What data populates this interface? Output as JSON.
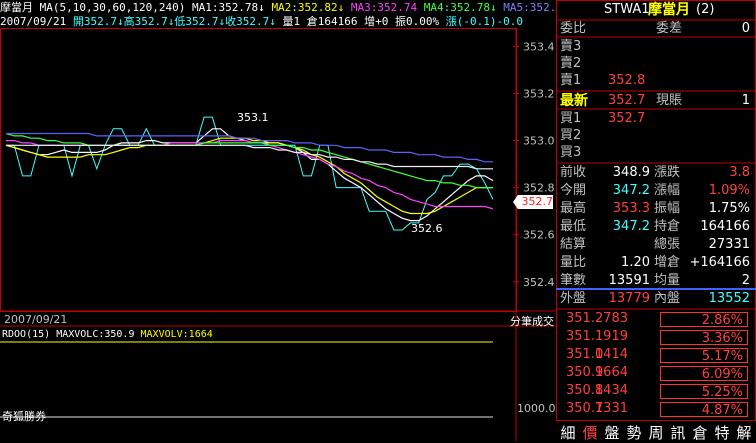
{
  "header": {
    "name": "摩當月",
    "ma_spec": "MA(5,10,30,60,120,240)",
    "ma1": "MA1:352.78↓",
    "ma2": "MA2:352.82↓",
    "ma3": "MA3:352.74",
    "ma4": "MA4:352.78↓",
    "ma5": "MA5:352.",
    "date": "2007/09/21",
    "open": "開352.7↓",
    "high": "高352.7↓",
    "low": "低352.7↓",
    "close": "收352.7↓",
    "volume": "量1",
    "oi": "倉164166",
    "oi_change": "增+0",
    "amplitude": "振0.00%",
    "change": "漲(-0.1)-0.0"
  },
  "chart": {
    "y_ticks": [
      "353.4",
      "353.2",
      "353.0",
      "352.8",
      "352.6",
      "352.4"
    ],
    "current_price_tag": "352.7",
    "annot_high": "353.1",
    "annot_low": "352.6",
    "bottom_date": "2007/09/21",
    "bottom_right_label": "分筆成交"
  },
  "chart_data": {
    "type": "line",
    "ylim": [
      352.28,
      353.47
    ],
    "x": [
      0,
      1,
      2,
      3,
      4,
      5,
      6,
      7,
      8,
      9,
      10,
      11,
      12,
      13,
      14,
      15,
      16,
      17,
      18,
      19,
      20,
      21,
      22,
      23,
      24,
      25,
      26,
      27,
      28,
      29,
      30,
      31,
      32,
      33,
      34,
      35,
      36,
      37,
      38,
      39,
      40,
      41,
      42,
      43,
      44,
      45,
      46,
      47,
      48,
      49,
      50,
      51,
      52,
      53,
      54,
      55,
      56,
      57,
      58,
      59
    ],
    "series": [
      {
        "color": "#40ffff",
        "values": [
          352.98,
          352.98,
          352.85,
          352.85,
          352.98,
          352.98,
          352.98,
          352.98,
          352.85,
          352.98,
          352.98,
          352.88,
          352.98,
          353.05,
          353.05,
          352.98,
          352.98,
          353.05,
          352.98,
          352.98,
          352.98,
          352.98,
          352.98,
          352.98,
          353.1,
          353.1,
          352.98,
          352.98,
          352.98,
          352.98,
          352.98,
          352.98,
          352.98,
          352.98,
          352.98,
          352.98,
          352.85,
          352.85,
          352.98,
          352.98,
          352.8,
          352.8,
          352.8,
          352.8,
          352.7,
          352.7,
          352.7,
          352.62,
          352.62,
          352.65,
          352.65,
          352.75,
          352.78,
          352.85,
          352.85,
          352.9,
          352.9,
          352.88,
          352.82,
          352.75
        ]
      },
      {
        "color": "#ffffff",
        "values": [
          352.98,
          352.97,
          352.96,
          352.95,
          352.94,
          352.94,
          352.95,
          352.96,
          352.95,
          352.95,
          352.95,
          352.95,
          352.96,
          352.98,
          352.99,
          352.99,
          352.99,
          353.0,
          353.0,
          352.99,
          352.99,
          352.99,
          352.99,
          352.99,
          353.02,
          353.05,
          353.05,
          353.02,
          353.01,
          353.0,
          352.99,
          352.99,
          352.99,
          352.99,
          352.98,
          352.97,
          352.95,
          352.92,
          352.92,
          352.9,
          352.87,
          352.84,
          352.82,
          352.8,
          352.77,
          352.74,
          352.71,
          352.69,
          352.67,
          352.66,
          352.66,
          352.68,
          352.71,
          352.74,
          352.77,
          352.8,
          352.83,
          352.85,
          352.85,
          352.83
        ]
      },
      {
        "color": "#ffff00",
        "values": [
          352.98,
          352.97,
          352.96,
          352.95,
          352.94,
          352.93,
          352.93,
          352.93,
          352.93,
          352.93,
          352.94,
          352.94,
          352.94,
          352.95,
          352.96,
          352.97,
          352.97,
          352.98,
          352.98,
          352.98,
          352.98,
          352.98,
          352.98,
          352.98,
          352.99,
          353.0,
          353.01,
          353.01,
          353.01,
          353.01,
          353.0,
          353.0,
          352.99,
          352.99,
          352.98,
          352.97,
          352.96,
          352.94,
          352.93,
          352.91,
          352.89,
          352.86,
          352.84,
          352.82,
          352.79,
          352.76,
          352.74,
          352.72,
          352.7,
          352.69,
          352.69,
          352.69,
          352.7,
          352.72,
          352.74,
          352.76,
          352.78,
          352.8,
          352.8,
          352.8
        ]
      },
      {
        "color": "#ff40ff",
        "values": [
          353.0,
          353.0,
          352.99,
          352.99,
          352.98,
          352.98,
          352.98,
          352.98,
          352.98,
          352.98,
          352.98,
          352.98,
          352.98,
          352.98,
          352.98,
          352.98,
          352.98,
          352.98,
          352.98,
          352.98,
          352.99,
          352.99,
          352.99,
          352.99,
          352.99,
          352.99,
          353.0,
          353.0,
          353.0,
          353.0,
          352.99,
          352.99,
          352.98,
          352.97,
          352.96,
          352.95,
          352.94,
          352.93,
          352.92,
          352.9,
          352.89,
          352.87,
          352.86,
          352.84,
          352.83,
          352.81,
          352.8,
          352.78,
          352.77,
          352.75,
          352.74,
          352.73,
          352.72,
          352.72,
          352.72,
          352.72,
          352.72,
          352.72,
          352.72,
          352.71
        ]
      },
      {
        "color": "#40ff40",
        "values": [
          353.03,
          353.02,
          353.02,
          353.01,
          353.01,
          353.0,
          353.0,
          352.99,
          352.99,
          352.99,
          352.98,
          352.98,
          352.98,
          352.98,
          352.98,
          352.98,
          352.98,
          352.98,
          352.98,
          352.98,
          352.98,
          352.98,
          352.98,
          352.98,
          352.99,
          352.99,
          352.99,
          352.99,
          352.99,
          352.99,
          352.99,
          352.99,
          352.98,
          352.98,
          352.98,
          352.97,
          352.97,
          352.96,
          352.96,
          352.95,
          352.94,
          352.93,
          352.92,
          352.91,
          352.9,
          352.89,
          352.88,
          352.87,
          352.86,
          352.85,
          352.84,
          352.83,
          352.83,
          352.82,
          352.82,
          352.81,
          352.81,
          352.8,
          352.8,
          352.8
        ]
      },
      {
        "color": "#6060ff",
        "values": [
          353.03,
          353.03,
          353.03,
          353.03,
          353.03,
          353.03,
          353.03,
          353.03,
          353.03,
          353.03,
          353.03,
          353.02,
          353.02,
          353.02,
          353.02,
          353.02,
          353.02,
          353.02,
          353.02,
          353.02,
          353.02,
          353.02,
          353.02,
          353.02,
          353.02,
          353.02,
          353.02,
          353.02,
          353.01,
          353.01,
          353.01,
          353.0,
          353.0,
          353.0,
          353.0,
          352.99,
          352.99,
          352.99,
          352.98,
          352.98,
          352.98,
          352.97,
          352.97,
          352.97,
          352.96,
          352.96,
          352.96,
          352.95,
          352.95,
          352.95,
          352.94,
          352.94,
          352.94,
          352.93,
          352.93,
          352.93,
          352.92,
          352.92,
          352.91,
          352.91
        ]
      },
      {
        "color": "#f0f0f0",
        "values": [
          352.98,
          352.98,
          352.98,
          352.98,
          352.98,
          352.98,
          352.98,
          352.98,
          352.98,
          352.98,
          352.98,
          352.98,
          352.98,
          352.98,
          352.98,
          352.98,
          352.98,
          352.98,
          352.98,
          352.98,
          352.98,
          352.98,
          352.98,
          352.98,
          352.98,
          352.98,
          352.98,
          352.98,
          352.98,
          352.98,
          352.97,
          352.97,
          352.97,
          352.96,
          352.96,
          352.95,
          352.95,
          352.94,
          352.94,
          352.93,
          352.93,
          352.92,
          352.92,
          352.91,
          352.91,
          352.9,
          352.9,
          352.89,
          352.89,
          352.89,
          352.89,
          352.89,
          352.89,
          352.89,
          352.89,
          352.89,
          352.89,
          352.88,
          352.88,
          352.88
        ]
      }
    ]
  },
  "volume_panel": {
    "indicator": "RDOO(15)",
    "maxvolc": "MAXVOLC:350.9",
    "maxvolv": "MAXVOLV:1664",
    "tick": "1000.0",
    "source": "奇狐勝券"
  },
  "quote": {
    "title_code": "STWA1",
    "title_name": "摩當月",
    "title_num": "(2)",
    "weibi_label": "委比",
    "weicha_label": "委差",
    "weicha_value": "0",
    "sell3": "賣3",
    "sell2": "賣2",
    "sell1": "賣1",
    "sell1_price": "352.8",
    "last_label": "最新",
    "last_price": "352.7",
    "now_label": "現賬",
    "now_value": "1",
    "buy1": "買1",
    "buy1_price": "352.7",
    "buy2": "買2",
    "buy3": "買3",
    "stats": [
      {
        "l": "前收",
        "v": "348.9",
        "l2": "漲跌",
        "v2": "3.8",
        "c": "white",
        "c2": "red"
      },
      {
        "l": "今開",
        "v": "347.2",
        "l2": "漲幅",
        "v2": "1.09%",
        "c": "cyan",
        "c2": "red"
      },
      {
        "l": "最高",
        "v": "353.3",
        "l2": "振幅",
        "v2": "1.75%",
        "c": "red",
        "c2": "white"
      },
      {
        "l": "最低",
        "v": "347.2",
        "l2": "持倉",
        "v2": "164166",
        "c": "cyan",
        "c2": "white"
      },
      {
        "l": "結算",
        "v": "",
        "l2": "總張",
        "v2": "27331",
        "c": "white",
        "c2": "white"
      },
      {
        "l": "量比",
        "v": "1.20",
        "l2": "增倉",
        "v2": "+164166",
        "c": "white",
        "c2": "white"
      },
      {
        "l": "筆數",
        "v": "13591",
        "l2": "均量",
        "v2": "2",
        "c": "white",
        "c2": "white"
      }
    ],
    "outer_label": "外盤",
    "outer_value": "13779",
    "inner_label": "內盤",
    "inner_value": "13552"
  },
  "ticks": [
    {
      "price": "351.2",
      "vol": "783",
      "pct": "2.86%"
    },
    {
      "price": "351.1",
      "vol": "919",
      "pct": "3.36%"
    },
    {
      "price": "351.0",
      "vol": "1414",
      "pct": "5.17%"
    },
    {
      "price": "350.9",
      "vol": "1664",
      "pct": "6.09%"
    },
    {
      "price": "350.8",
      "vol": "1434",
      "pct": "5.25%"
    },
    {
      "price": "350.7",
      "vol": "1331",
      "pct": "4.87%"
    }
  ],
  "tabs": [
    "細",
    "價",
    "盤",
    "勢",
    "周",
    "訊",
    "倉",
    "特",
    "解"
  ],
  "colors": {
    "up": "#ff4040",
    "down": "#40ffff",
    "frame": "#c00000",
    "grid": "#c00000"
  }
}
